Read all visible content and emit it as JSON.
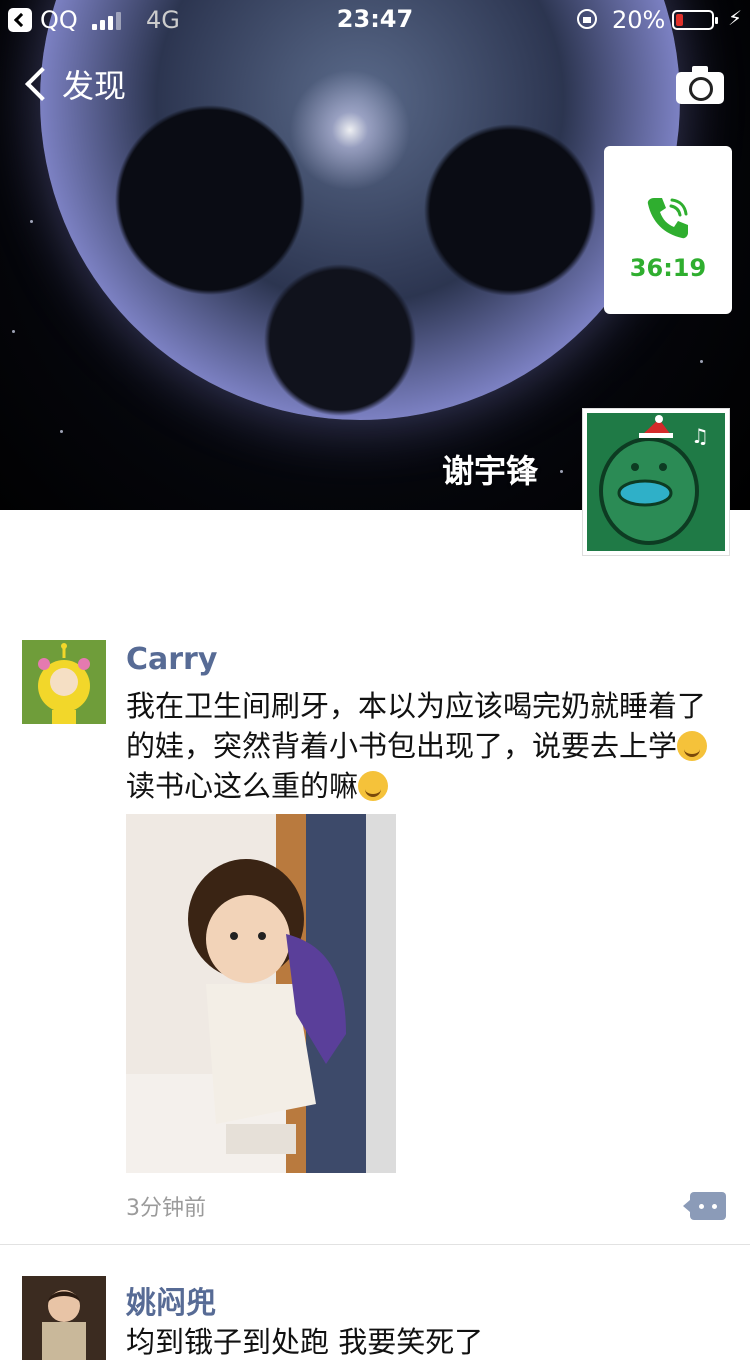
{
  "status_bar": {
    "app_name": "QQ",
    "network": "4G",
    "time": "23:47",
    "battery_percent": "20%",
    "battery_level": 0.2
  },
  "nav": {
    "back_label": "发现"
  },
  "call_widget": {
    "duration": "36:19"
  },
  "profile": {
    "name": "谢宇锋"
  },
  "posts": [
    {
      "author": "Carry",
      "text_part1": "我在卫生间刷牙，本以为应该喝完奶就睡着了的娃，突然背着小书包出现了，说要去上学",
      "text_part2": "读书心这么重的嘛",
      "time": "3分钟前"
    },
    {
      "author": "姚闷兜",
      "text": "均到锇子到处跑 我要笑死了"
    }
  ],
  "colors": {
    "author_name": "#576b95",
    "call_green": "#2fae2f",
    "timestamp": "#9b9b9b"
  }
}
